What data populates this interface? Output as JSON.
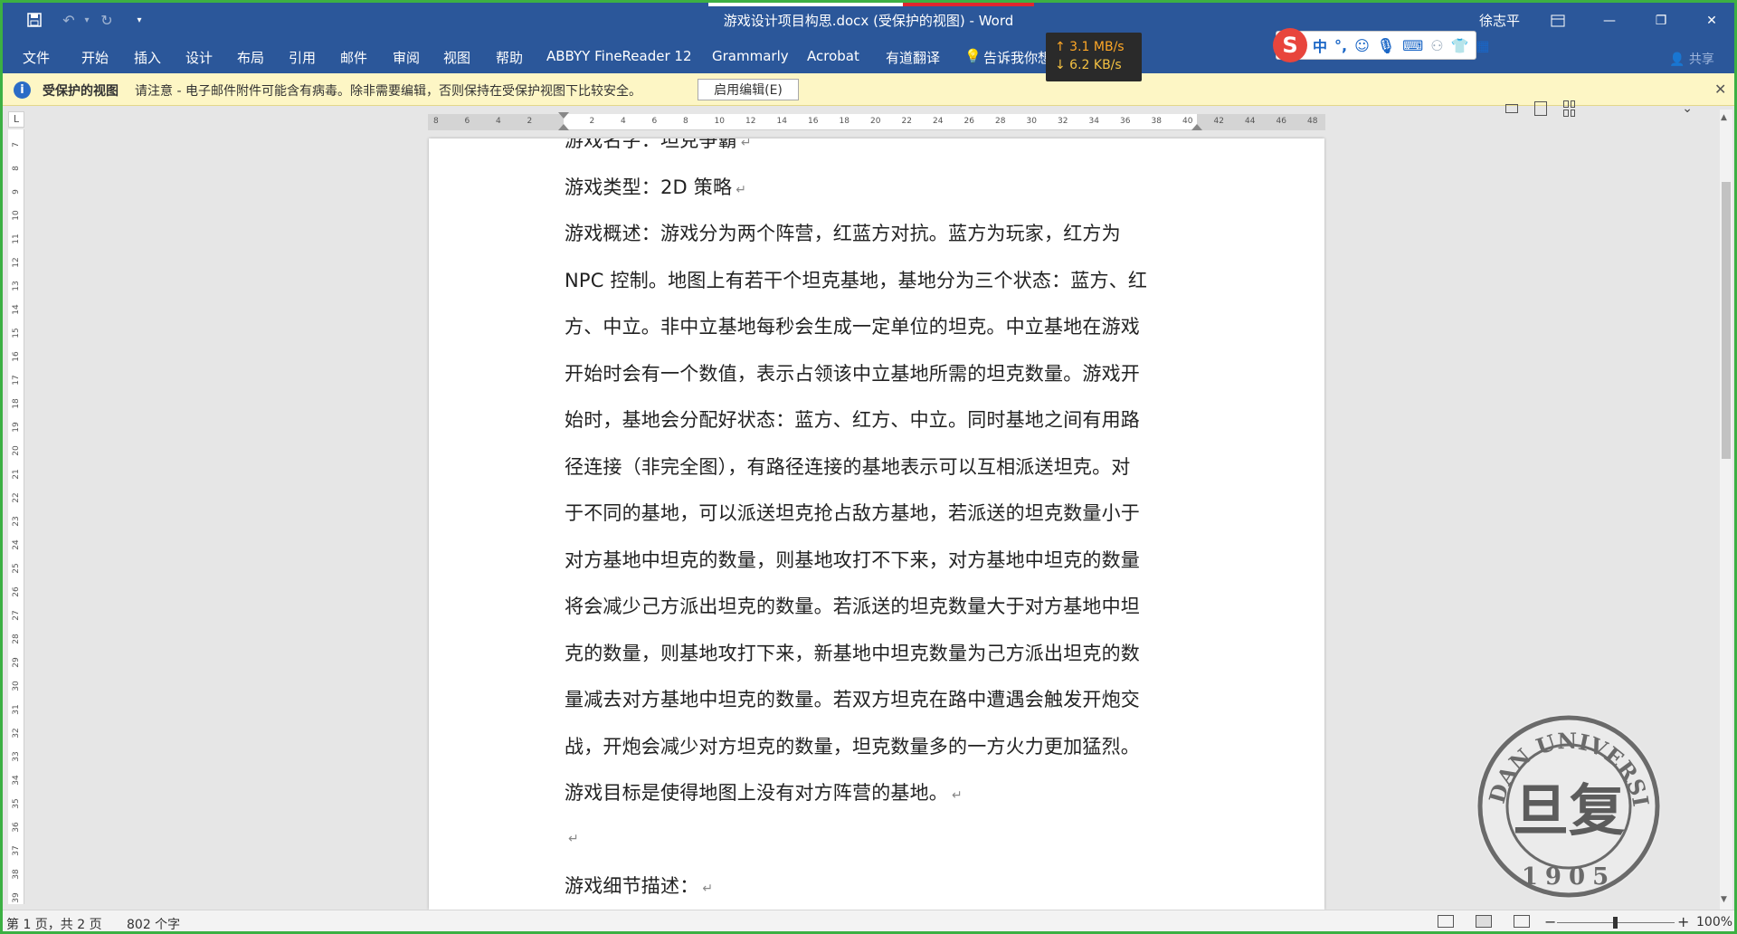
{
  "window": {
    "title": "游戏设计项目构思.docx (受保护的视图)  -  Word",
    "user": "徐志平"
  },
  "ribbon": {
    "tabs": [
      "文件",
      "开始",
      "插入",
      "设计",
      "布局",
      "引用",
      "邮件",
      "审阅",
      "视图",
      "帮助",
      "ABBYY FineReader 12",
      "Grammarly",
      "Acrobat",
      "有道翻译"
    ],
    "tell_me": "告诉我你想",
    "share": "共享"
  },
  "net_speed": {
    "up": "↑ 3.1 MB/s",
    "down": "↓ 6.2 KB/s"
  },
  "ime": {
    "logo": "S",
    "lang": "中"
  },
  "protected_view": {
    "title": "受保护的视图",
    "message": "请注意 - 电子邮件附件可能含有病毒。除非需要编辑，否则保持在受保护视图下比较安全。",
    "enable_button": "启用编辑(E)"
  },
  "ruler": {
    "corner": "L",
    "h_numbers": [
      "8",
      "6",
      "4",
      "2",
      "",
      "2",
      "4",
      "6",
      "8",
      "10",
      "12",
      "14",
      "16",
      "18",
      "20",
      "22",
      "24",
      "26",
      "28",
      "30",
      "32",
      "34",
      "36",
      "38",
      "40",
      "42",
      "44",
      "46",
      "48"
    ],
    "v_numbers": [
      "7",
      "8",
      "9",
      "10",
      "11",
      "12",
      "13",
      "14",
      "15",
      "16",
      "17",
      "18",
      "19",
      "20",
      "21",
      "22",
      "23",
      "24",
      "25",
      "26",
      "27",
      "28",
      "29",
      "30",
      "31",
      "32",
      "33",
      "34",
      "35",
      "36",
      "37",
      "38",
      "39"
    ]
  },
  "document": {
    "lines": [
      "游戏名字：坦克争霸",
      "游戏类型：2D 策略",
      "游戏概述：游戏分为两个阵营，红蓝方对抗。蓝方为玩家，红方为",
      "NPC 控制。地图上有若干个坦克基地，基地分为三个状态：蓝方、红",
      "方、中立。非中立基地每秒会生成一定单位的坦克。中立基地在游戏",
      "开始时会有一个数值，表示占领该中立基地所需的坦克数量。游戏开",
      "始时，基地会分配好状态：蓝方、红方、中立。同时基地之间有用路",
      "径连接（非完全图），有路径连接的基地表示可以互相派送坦克。对",
      "于不同的基地，可以派送坦克抢占敌方基地，若派送的坦克数量小于",
      "对方基地中坦克的数量，则基地攻打不下来，对方基地中坦克的数量",
      "将会减少己方派出坦克的数量。若派送的坦克数量大于对方基地中坦",
      "克的数量，则基地攻打下来，新基地中坦克数量为己方派出坦克的数",
      "量减去对方基地中坦克的数量。若双方坦克在路中遭遇会触发开炮交",
      "战，开炮会减少对方坦克的数量，坦克数量多的一方火力更加猛烈。",
      "游戏目标是使得地图上没有对方阵营的基地。",
      "",
      "游戏细节描述："
    ],
    "para_mark": "↵"
  },
  "seal": {
    "text_top": "FUDAN UNIVERSITY",
    "year": "1905",
    "center": "旦复"
  },
  "status": {
    "page": "第 1 页，共 2 页",
    "words": "802 个字",
    "zoom": "100%"
  }
}
